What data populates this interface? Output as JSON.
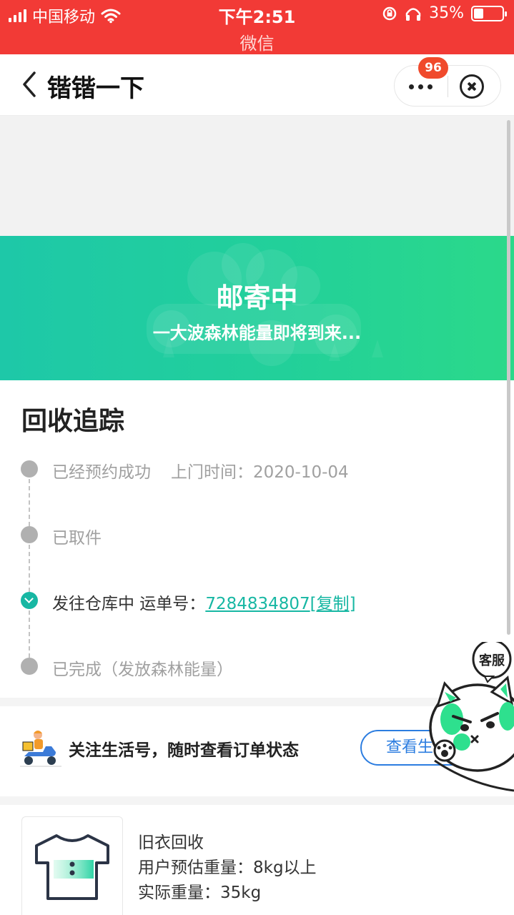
{
  "status_bar": {
    "carrier": "中国移动",
    "time": "下午2:51",
    "app_name": "微信",
    "battery_text": "35%",
    "battery_level": 0.35
  },
  "nav": {
    "title": "锴锴一下",
    "badge_count": "96"
  },
  "banner": {
    "title": "邮寄中",
    "subtitle": "一大波森林能量即将到来..."
  },
  "tracking": {
    "title": "回收追踪",
    "steps": [
      {
        "label": "已经预约成功",
        "extra": "上门时间：2020-10-04",
        "active": false
      },
      {
        "label": "已取件",
        "extra": "",
        "active": false
      },
      {
        "label": "发往仓库中 运单号：",
        "tracking_number": "7284834807",
        "copy_label": "[复制]",
        "active": true
      },
      {
        "label": "已完成（发放森林能量）",
        "extra": "",
        "active": false
      }
    ]
  },
  "follow": {
    "text": "关注生活号，随时查看订单状态",
    "button_label": "查看生"
  },
  "item": {
    "name": "旧衣回收",
    "estimate": "用户预估重量：8kg以上",
    "actual": "实际重量：35kg"
  },
  "service": {
    "label": "客服"
  },
  "colors": {
    "status_bar": "#f23a36",
    "banner_start": "#1ec8a8",
    "banner_end": "#2bd98a",
    "accent_teal": "#17b7a3",
    "button_blue": "#2c7de0",
    "badge": "#f04a2c"
  },
  "icons": [
    "signal-icon",
    "wifi-icon",
    "rotation-lock-icon",
    "headphones-icon",
    "battery-icon",
    "back-chevron-icon",
    "more-dots-icon",
    "close-circle-icon",
    "check-icon",
    "scooter-courier-icon",
    "tshirt-icon",
    "mascot-cat-icon"
  ]
}
